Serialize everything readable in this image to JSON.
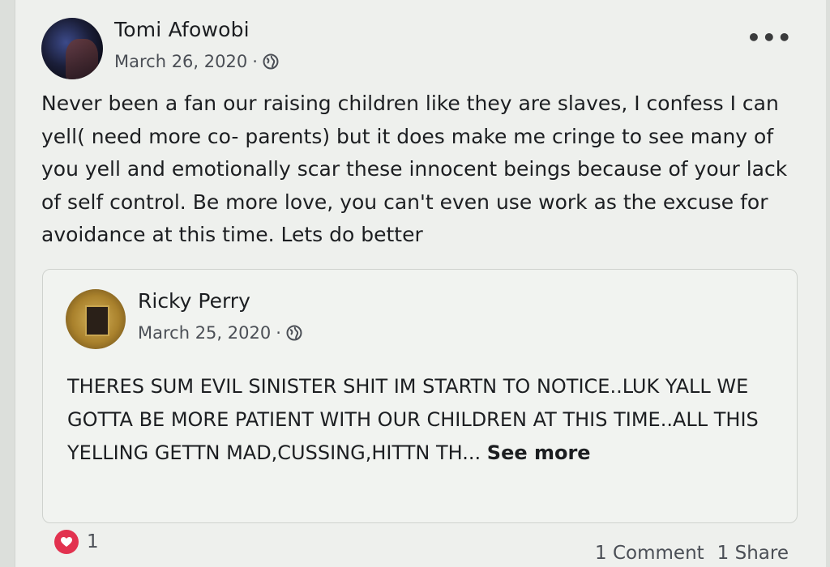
{
  "post": {
    "author": "Tomi Afowobi",
    "date": "March 26, 2020",
    "separator": "·",
    "audience_icon": "globe-icon",
    "more_label": "•••",
    "text": "Never been a fan our raising children like they are slaves, I confess I can yell( need more co- parents) but it does make me cringe to see many of you yell and emotionally scar these innocent beings because of your lack of self control. Be more love, you can't even use work as the excuse for avoidance at this time. Lets do better"
  },
  "shared_post": {
    "author": "Ricky Perry",
    "date": "March 25, 2020",
    "separator": "·",
    "audience_icon": "globe-icon",
    "text": "THERES SUM EVIL SINISTER SHIT IM STARTN TO NOTICE..LUK YALL WE GOTTA BE MORE PATIENT WITH OUR CHILDREN AT THIS TIME..ALL THIS YELLING GETTN MAD,CUSSING,HITTN TH...",
    "see_more": "See more"
  },
  "footer": {
    "reaction_icon": "heart-icon",
    "reaction_color": "#e2324f",
    "reaction_count": "1",
    "comments": "1 Comment",
    "shares": "1 Share"
  }
}
